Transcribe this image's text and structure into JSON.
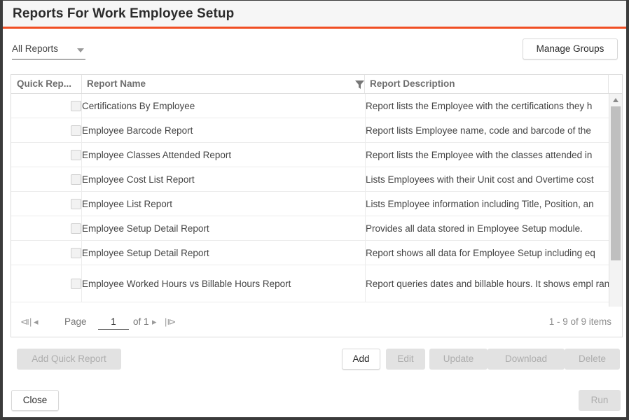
{
  "window": {
    "title": "Reports For Work Employee Setup",
    "accent_color": "#f04e23",
    "border_color": "#3b3b3b"
  },
  "toolbar": {
    "report_group_selected": "All Reports",
    "report_group_caret_icon": "chevron-down-icon",
    "manage_groups_label": "Manage Groups"
  },
  "grid": {
    "columns": [
      {
        "key": "quick_report",
        "label": "Quick Rep...",
        "filter_icon": null
      },
      {
        "key": "report_name",
        "label": "Report Name",
        "filter_icon": "filter-funnel-icon"
      },
      {
        "key": "report_description",
        "label": "Report Description",
        "filter_icon": null
      }
    ],
    "rows": [
      {
        "quick_report_checked": false,
        "report_name": "Certifications By Employee",
        "report_description": "Report lists the Employee with the certifications they h"
      },
      {
        "quick_report_checked": false,
        "report_name": "Employee Barcode Report",
        "report_description": "Report lists Employee name, code and barcode of the "
      },
      {
        "quick_report_checked": false,
        "report_name": "Employee Classes Attended Report",
        "report_description": "Report lists the Employee with the classes attended in"
      },
      {
        "quick_report_checked": false,
        "report_name": "Employee Cost List Report",
        "report_description": "Lists Employees with their Unit cost and Overtime cost"
      },
      {
        "quick_report_checked": false,
        "report_name": "Employee List Report",
        "report_description": "Lists Employee information including Title, Position, an"
      },
      {
        "quick_report_checked": false,
        "report_name": "Employee Setup Detail Report",
        "report_description": "Provides all data stored in Employee Setup module."
      },
      {
        "quick_report_checked": false,
        "report_name": "Employee Setup Detail Report",
        "report_description": "Report shows all data for Employee Setup including eq"
      },
      {
        "quick_report_checked": false,
        "report_name": "Employee Worked Hours vs Billable Hours Report",
        "report_description": "Report queries dates and billable hours. It shows empl range and the percent of worked to billable hours."
      }
    ],
    "vertical_scrollbar": {
      "up_arrow_icon": "caret-up-icon",
      "down_arrow_icon": "caret-down-icon"
    },
    "horizontal_scrollbar": {
      "left_arrow_icon": "caret-left-icon",
      "right_arrow_icon": "caret-right-icon"
    }
  },
  "pager": {
    "first_icon": "⧏|",
    "prev_icon": "◂",
    "next_icon": "▸",
    "last_icon": "|⧐",
    "page_label": "Page",
    "page_value": "1",
    "of_label": "of 1",
    "items_label": "1 - 9 of 9 items"
  },
  "actions": {
    "add_quick_report": {
      "label": "Add Quick Report",
      "enabled": false
    },
    "add": {
      "label": "Add",
      "enabled": true
    },
    "edit": {
      "label": "Edit",
      "enabled": false
    },
    "update": {
      "label": "Update",
      "enabled": false
    },
    "download": {
      "label": "Download",
      "enabled": false
    },
    "delete": {
      "label": "Delete",
      "enabled": false
    },
    "close": {
      "label": "Close",
      "enabled": true
    },
    "run": {
      "label": "Run",
      "enabled": false
    }
  }
}
